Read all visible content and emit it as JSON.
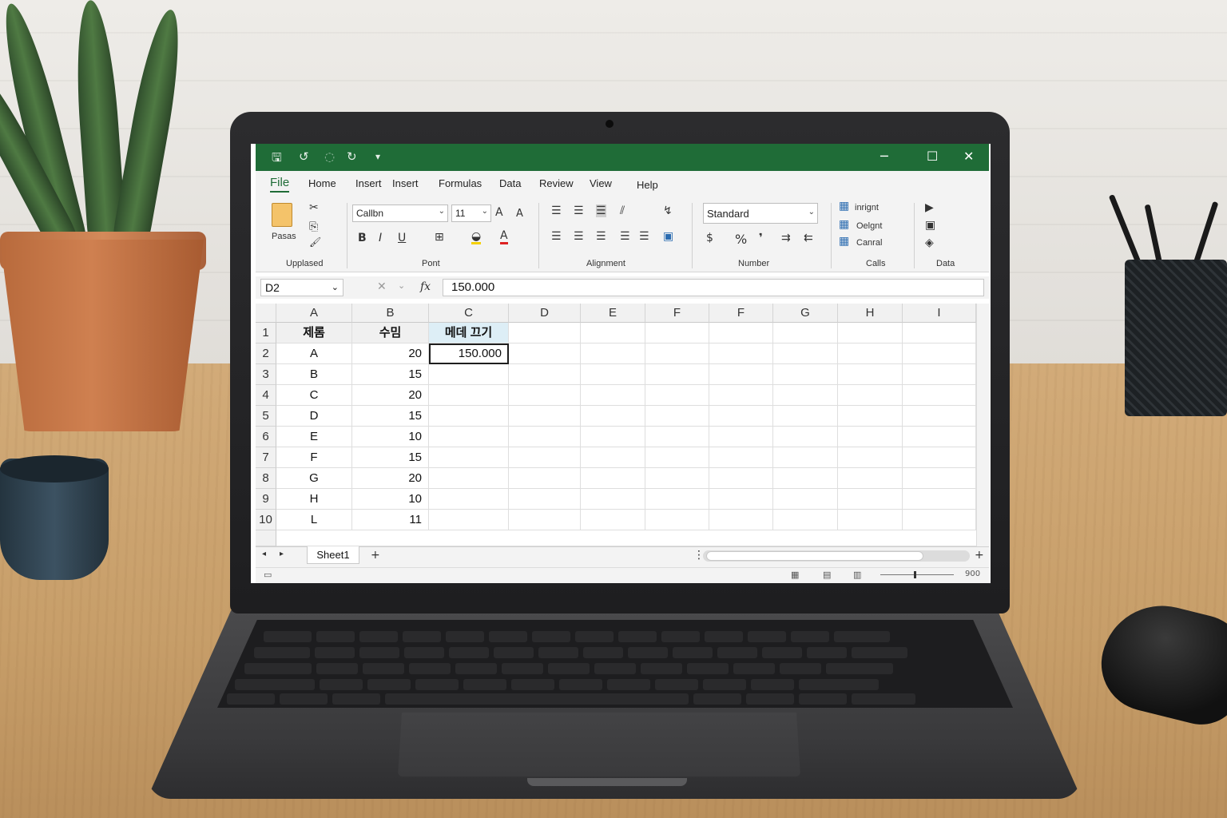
{
  "titlebar": {
    "icons": [
      "save-icon",
      "undo-icon",
      "redo-icon",
      "refresh-icon",
      "customize-icon"
    ],
    "glyphs": {
      "save": "🖫",
      "undo": "↺",
      "redo": "◌",
      "refresh": "↻",
      "customize": "▾"
    },
    "minimize": "─",
    "maximize": "☐",
    "close": "✕"
  },
  "tabs": [
    "File",
    "Home",
    "Insert",
    "Insert",
    "Formulas",
    "Data",
    "Review",
    "View",
    "Help"
  ],
  "ribbon": {
    "clipboard": {
      "paste_label": "Pasas",
      "group_label": "Upplased"
    },
    "font": {
      "font_name": "Callbn",
      "font_size": "11",
      "bold": "B",
      "italic": "I",
      "underline": "U",
      "font_color": "A",
      "grow": "A",
      "shrink": "A",
      "group_label": "Pont"
    },
    "alignment": {
      "group_label": "Alignment"
    },
    "number": {
      "format": "Standard",
      "currency": "$",
      "percent": "%",
      "comma": "❜",
      "group_label": "Number"
    },
    "cells": {
      "insert": "inrignt",
      "delete": "Oelgnt",
      "format": "Canral",
      "group_label": "Calls"
    },
    "data": {
      "group_label": "Data"
    }
  },
  "formula_bar": {
    "name_box": "D2",
    "fx": "fx",
    "value": "150.000"
  },
  "grid": {
    "columns": [
      "A",
      "B",
      "C",
      "D",
      "E",
      "F",
      "F",
      "G",
      "H",
      "I"
    ],
    "rows": [
      "1",
      "2",
      "3",
      "4",
      "5",
      "6",
      "7",
      "8",
      "9",
      "10"
    ],
    "data": [
      [
        "제롬",
        "수밈",
        "메데 끄기"
      ],
      [
        "A",
        "20",
        "150.000"
      ],
      [
        "B",
        "15",
        ""
      ],
      [
        "C",
        "20",
        ""
      ],
      [
        "D",
        "15",
        ""
      ],
      [
        "E",
        "10",
        ""
      ],
      [
        "F",
        "15",
        ""
      ],
      [
        "G",
        "20",
        ""
      ],
      [
        "H",
        "10",
        ""
      ],
      [
        "L",
        "11",
        ""
      ]
    ]
  },
  "sheets": {
    "active": "Sheet1",
    "add": "+"
  },
  "status": {
    "zoom": "900"
  },
  "colors": {
    "accent": "#1f6c37"
  }
}
